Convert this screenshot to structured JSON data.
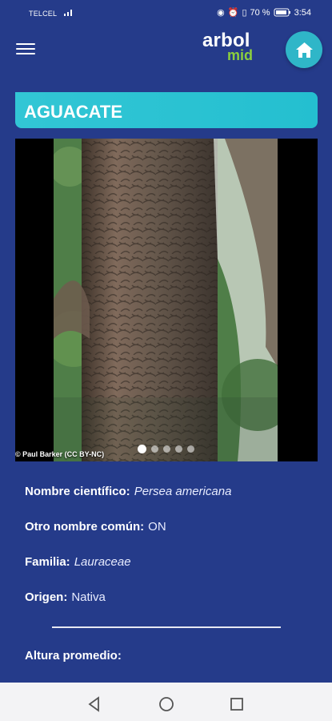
{
  "status": {
    "carrier": "TELCEL",
    "battery_percent": "70 %",
    "time": "3:54"
  },
  "header": {
    "logo_line1": "arbol",
    "logo_line2": "mid"
  },
  "tree": {
    "title": "AGUACATE",
    "photo_credit": "© Paul Barker (CC BY-NC)",
    "carousel": {
      "total": 5,
      "active": 1
    },
    "details": [
      {
        "label": "Nombre científico:",
        "value": "Persea americana",
        "italic": true
      },
      {
        "label": "Otro nombre común:",
        "value": "ON",
        "italic": false
      },
      {
        "label": "Familia:",
        "value": "Lauraceae",
        "italic": true
      },
      {
        "label": "Origen:",
        "value": "Nativa",
        "italic": false
      }
    ],
    "avg_height_label": "Altura promedio:"
  },
  "icons": {
    "menu": "hamburger-icon",
    "home": "home-icon",
    "back": "back-triangle-icon",
    "home_nav": "circle-home-icon",
    "recents": "square-recents-icon"
  }
}
